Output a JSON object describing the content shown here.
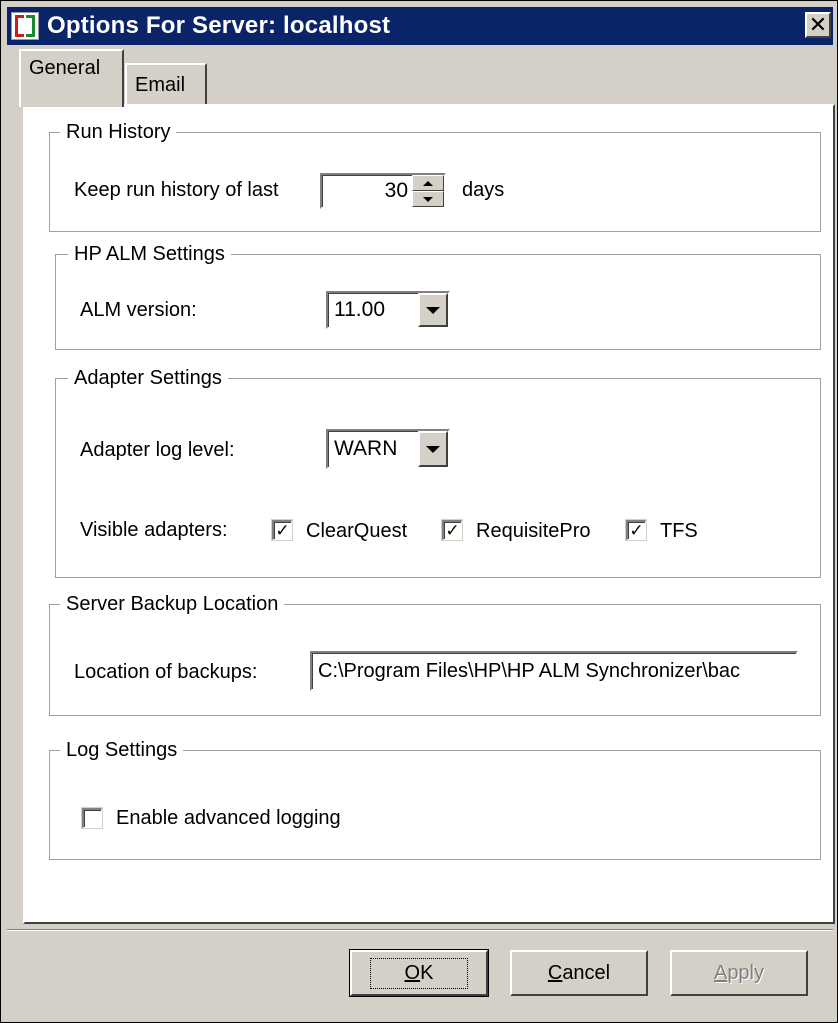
{
  "window": {
    "title": "Options For Server: localhost",
    "close_glyph": "✕"
  },
  "tabs": [
    {
      "label": "General",
      "active": true
    },
    {
      "label": "Email",
      "active": false
    }
  ],
  "run_history": {
    "legend": "Run History",
    "keep_label": "Keep run history of last",
    "days_value": "30",
    "days_unit": "days"
  },
  "alm_settings": {
    "legend": "HP ALM Settings",
    "version_label": "ALM version:",
    "version_value": "11.00"
  },
  "adapter_settings": {
    "legend": "Adapter Settings",
    "log_level_label": "Adapter log level:",
    "log_level_value": "WARN",
    "visible_label": "Visible adapters:",
    "adapters": [
      {
        "label": "ClearQuest",
        "checked": true
      },
      {
        "label": "RequisitePro",
        "checked": true
      },
      {
        "label": "TFS",
        "checked": true
      }
    ]
  },
  "backup": {
    "legend": "Server Backup Location",
    "location_label": "Location of backups:",
    "location_value": "C:\\Program Files\\HP\\HP ALM Synchronizer\\bac"
  },
  "log_settings": {
    "legend": "Log Settings",
    "advanced_label": "Enable advanced logging",
    "advanced_checked": false
  },
  "buttons": {
    "ok_first": "O",
    "ok_rest": "K",
    "cancel_first": "C",
    "cancel_rest": "ancel",
    "apply_first": "A",
    "apply_rest": "pply"
  },
  "colors": {
    "titlebar": "#0a246a",
    "face": "#d4d0c8",
    "panel": "#ffffff"
  }
}
